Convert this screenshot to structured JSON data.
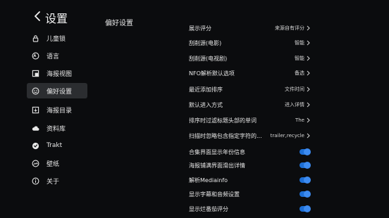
{
  "header": {
    "back_icon": "chevron-left-icon",
    "title": "设置"
  },
  "sidebar": {
    "items": [
      {
        "label": "儿童锁",
        "icon": "lock-icon",
        "active": false
      },
      {
        "label": "语言",
        "icon": "language-icon",
        "active": false
      },
      {
        "label": "海报视图",
        "icon": "poster-view-icon",
        "active": false
      },
      {
        "label": "偏好设置",
        "icon": "smiley-icon",
        "active": true
      },
      {
        "label": "海报目录",
        "icon": "poster-directory-icon",
        "active": false
      },
      {
        "label": "资料库",
        "icon": "cloud-icon",
        "active": false
      },
      {
        "label": "Trakt",
        "icon": "trakt-icon",
        "active": false
      },
      {
        "label": "壁纸",
        "icon": "wallpaper-icon",
        "active": false
      },
      {
        "label": "关于",
        "icon": "info-icon",
        "active": false
      }
    ]
  },
  "main": {
    "section_title": "偏好设置",
    "settings": [
      {
        "label": "展示评分",
        "value": "来源自有评分",
        "kind": "select"
      },
      {
        "label": "刮削源(电影)",
        "value": "智能",
        "kind": "select"
      },
      {
        "label": "刮削源(电视剧)",
        "value": "智能",
        "kind": "select"
      },
      {
        "label": "NFO解析默认选项",
        "value": "备选",
        "kind": "select"
      },
      {
        "label": "最近添加排序",
        "value": "文件时间",
        "kind": "select"
      },
      {
        "label": "默认进入方式",
        "value": "进入详情",
        "kind": "select"
      },
      {
        "label": "排序时过滤标题头部的单词",
        "value": "The",
        "kind": "select"
      },
      {
        "label": "扫描时忽略包含指定字符的...",
        "value": "trailer,recycle",
        "kind": "select"
      },
      {
        "label": "合集界面显示年份信息",
        "value": "on",
        "kind": "toggle"
      },
      {
        "label": "海报铺满界面滑出详情",
        "value": "on",
        "kind": "toggle"
      },
      {
        "label": "解析Mediainfo",
        "value": "on",
        "kind": "toggle"
      },
      {
        "label": "显示字幕和音频设置",
        "value": "on",
        "kind": "toggle"
      },
      {
        "label": "显示烂番茄评分",
        "value": "on",
        "kind": "toggle"
      }
    ]
  },
  "colors": {
    "background": "#0b0c0e",
    "active_item": "#2b2d30",
    "toggle_on": "#3d8bf0"
  }
}
